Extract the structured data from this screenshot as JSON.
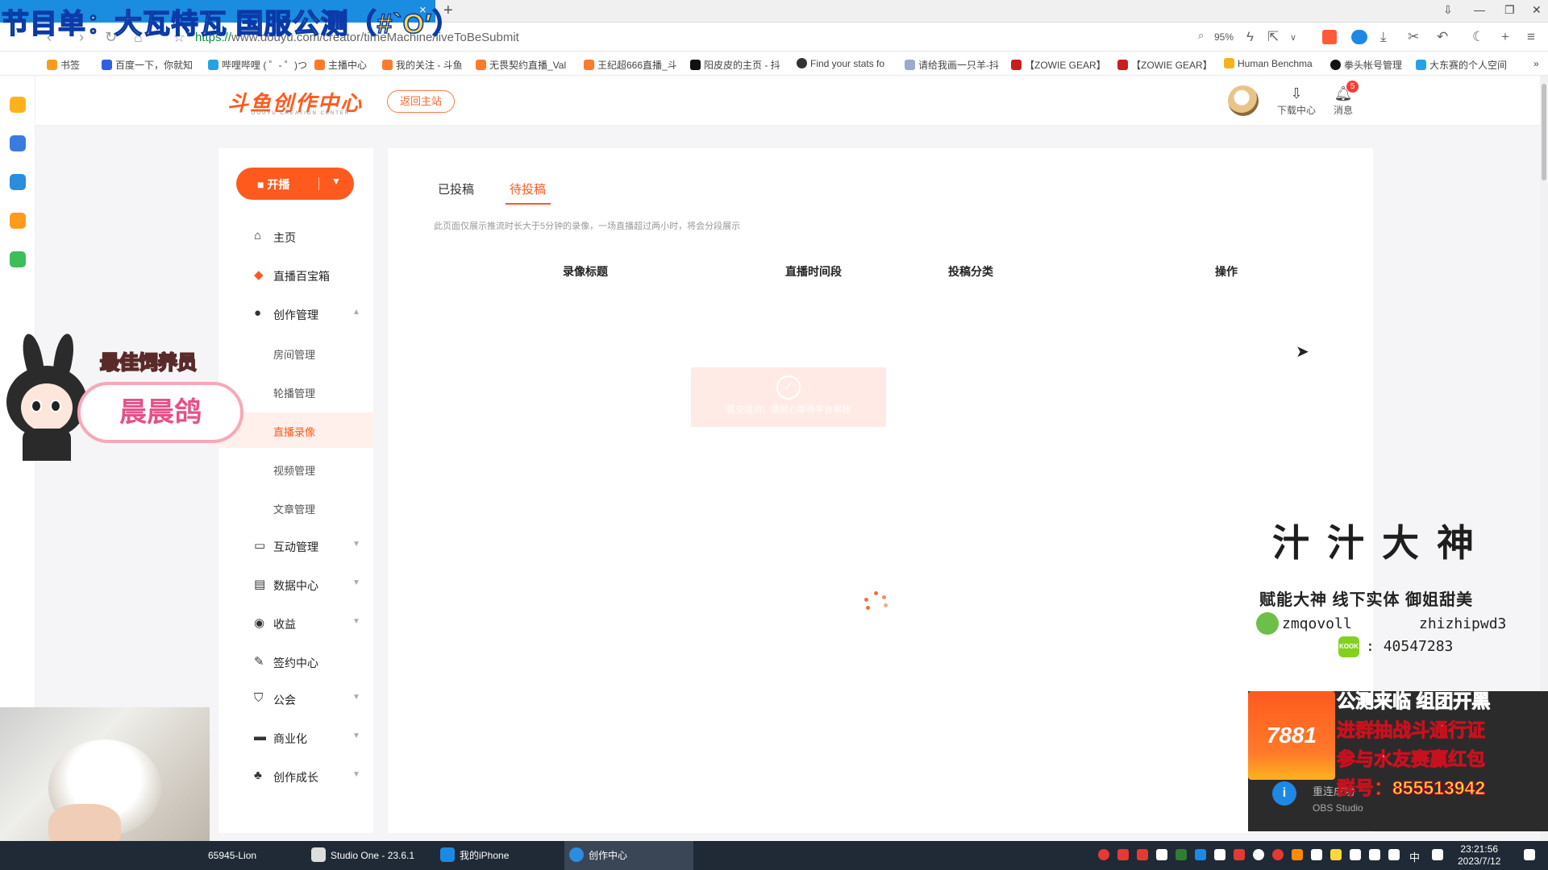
{
  "overlay": {
    "title": "节目单：大瓦特瓦 国服公测（#`O′）",
    "best_label": "最佳饲养员",
    "name": "晨晨鸽",
    "zz_title": "汁汁大神",
    "zz_slogan": "赋能大神 线下实体 御姐甜美",
    "zz_wechat": "zmqovoll",
    "zz_name2": "zhizhipwd3",
    "zz_kook": "40547283",
    "kook_badge": "KOOK",
    "promo_logo": "7881",
    "promo_lines": [
      "公测来临 组团开黑",
      "进群抽战斗通行证",
      "参与水友赛赢红包",
      "群号：855513942"
    ],
    "obs_note": "重连成功",
    "obs_sub": "OBS Studio",
    "obs_icon": "i"
  },
  "browser": {
    "url_scheme": "https://",
    "url_rest": "www.douyu.com/creator/timeMachine/liveToBeSubmit",
    "zoom": "95%",
    "bookmarks": [
      "书签",
      "百度一下，你就知",
      "哔哩哔哩 ( ゜- ゜)つ",
      "主播中心",
      "我的关注 - 斗鱼",
      "无畏契约直播_Val",
      "王纪超666直播_斗",
      "阳皮皮的主页 - 抖",
      "Find your stats fo",
      "请给我画一只羊-抖",
      "【ZOWIE GEAR】",
      "【ZOWIE GEAR】",
      "Human Benchma",
      "拳头帐号管理",
      "大东赛的个人空间"
    ]
  },
  "header": {
    "logo": "斗鱼创作中心",
    "logo_sub": "DOUYU CREATION CENTER",
    "back_label": "返回主站",
    "download_label": "下载中心",
    "message_label": "消息",
    "message_badge": "5"
  },
  "sidebar": {
    "live_label": "开播",
    "items": [
      {
        "label": "主页",
        "icon": "home-icon"
      },
      {
        "label": "直播百宝箱",
        "icon": "box-icon"
      },
      {
        "label": "创作管理",
        "icon": "bulb-icon"
      },
      {
        "label": "房间管理"
      },
      {
        "label": "轮播管理"
      },
      {
        "label": "直播录像"
      },
      {
        "label": "视频管理"
      },
      {
        "label": "文章管理"
      },
      {
        "label": "互动管理",
        "icon": "chat-icon"
      },
      {
        "label": "数据中心",
        "icon": "chart-icon"
      },
      {
        "label": "收益",
        "icon": "coin-icon"
      },
      {
        "label": "签约中心",
        "icon": "sign-icon"
      },
      {
        "label": "公会",
        "icon": "guild-icon"
      },
      {
        "label": "商业化",
        "icon": "business-icon"
      },
      {
        "label": "创作成长",
        "icon": "sprout-icon"
      }
    ]
  },
  "main": {
    "tabs": [
      "已投稿",
      "待投稿"
    ],
    "active_tab": "待投稿",
    "notice": "此页面仅展示推流时长大于5分钟的录像，一场直播超过两小时，将会分段展示",
    "columns": [
      "录像标题",
      "直播时间段",
      "投稿分类",
      "操作"
    ],
    "toast_text": "提交成功，请耐心等待平台审核",
    "toast_icon": "✓"
  },
  "taskbar": {
    "items": [
      "65945-Lion",
      "Studio One - 23.6.1",
      "我的iPhone",
      "创作中心"
    ],
    "time": "23:21:56",
    "date": "2023/7/12",
    "ime": "中"
  }
}
